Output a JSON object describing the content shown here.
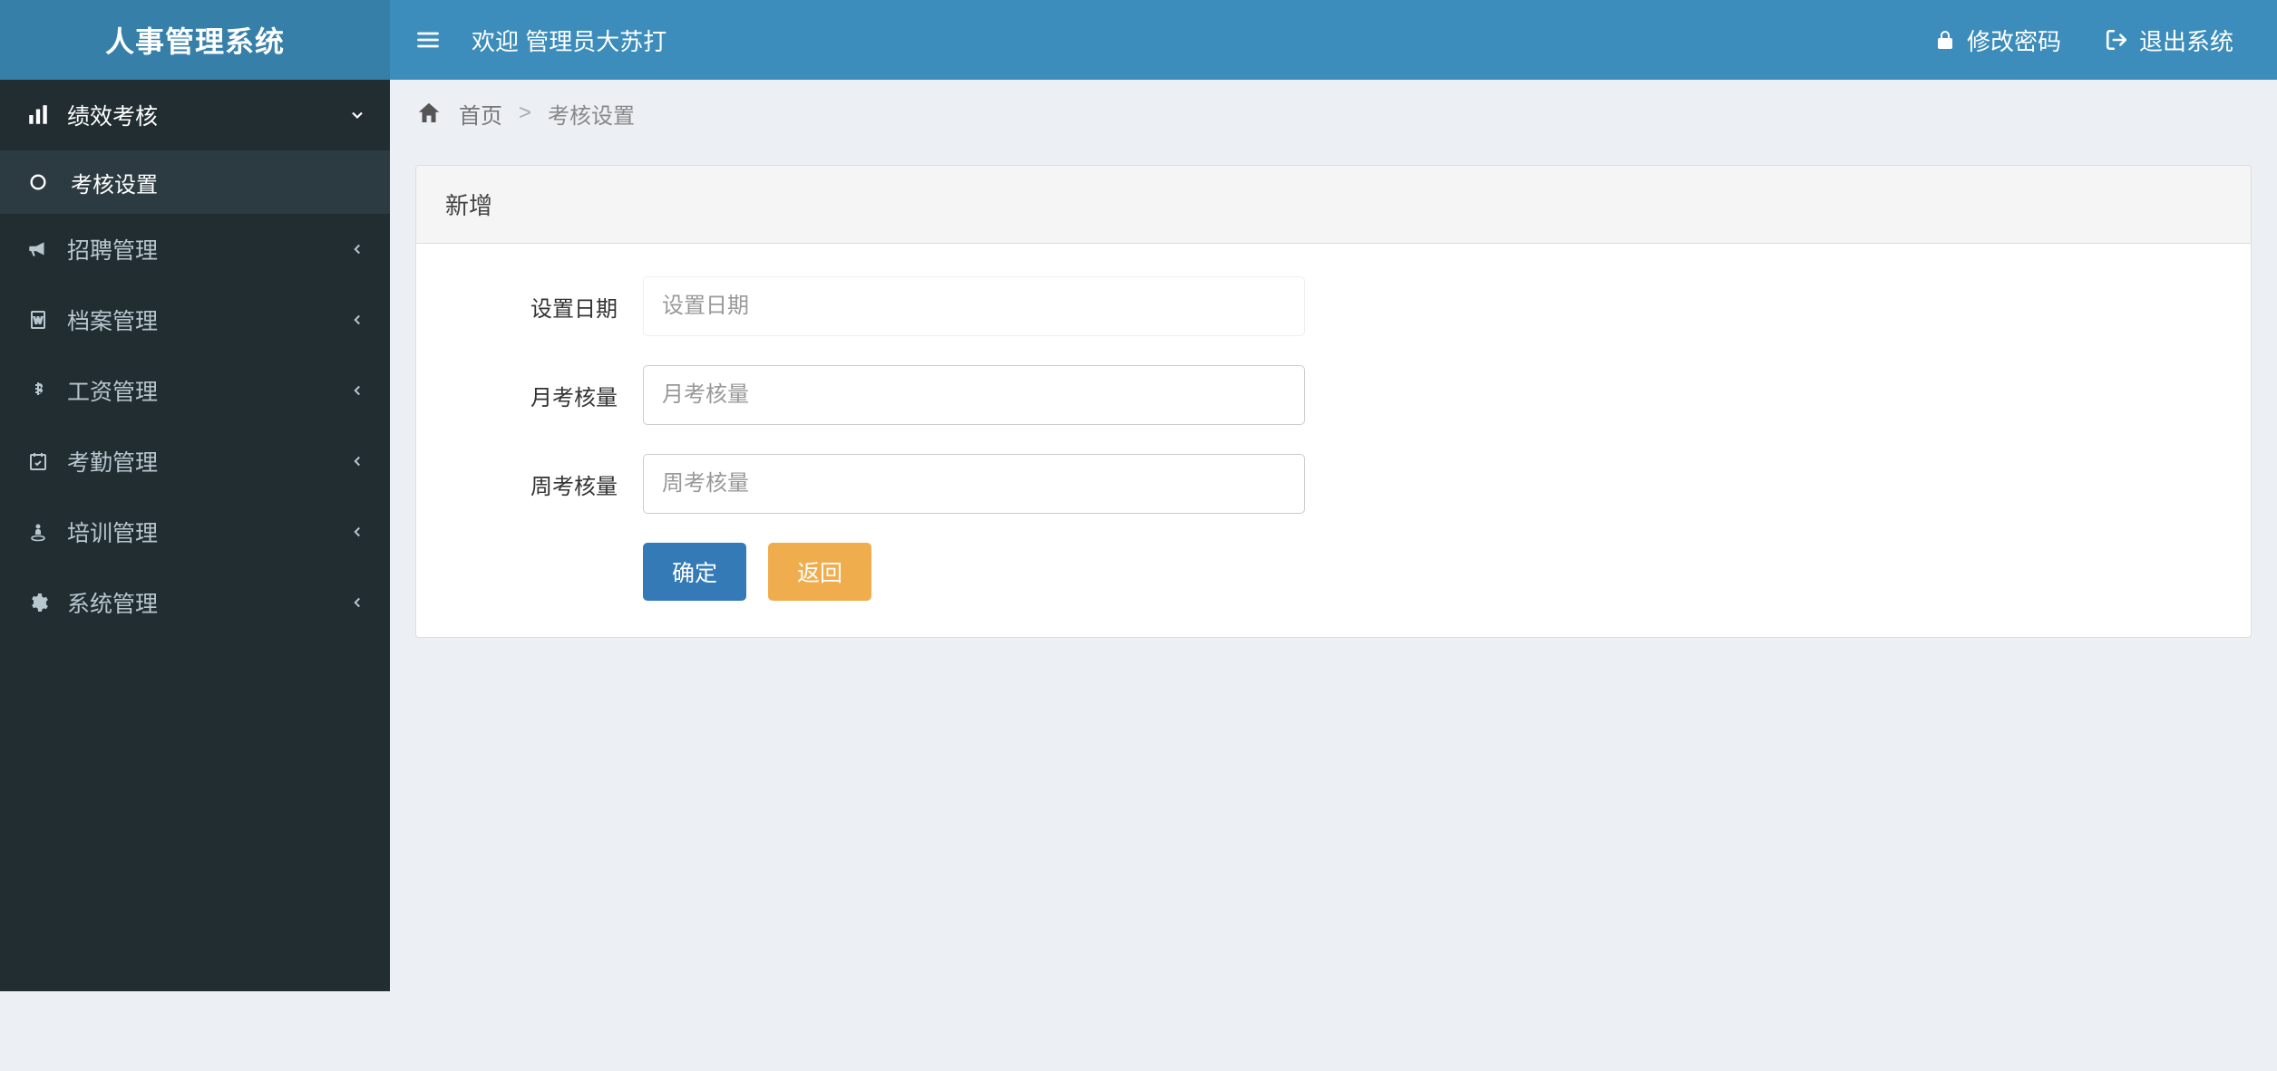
{
  "app": {
    "title": "人事管理系统"
  },
  "header": {
    "welcome": "欢迎 管理员大苏打",
    "change_password": "修改密码",
    "logout": "退出系统"
  },
  "sidebar": {
    "items": [
      {
        "label": "绩效考核",
        "expanded": true,
        "children": [
          {
            "label": "考核设置"
          }
        ]
      },
      {
        "label": "招聘管理"
      },
      {
        "label": "档案管理"
      },
      {
        "label": "工资管理"
      },
      {
        "label": "考勤管理"
      },
      {
        "label": "培训管理"
      },
      {
        "label": "系统管理"
      }
    ]
  },
  "breadcrumb": {
    "home": "首页",
    "current": "考核设置"
  },
  "panel": {
    "title": "新增"
  },
  "form": {
    "date_label": "设置日期",
    "date_placeholder": "设置日期",
    "month_label": "月考核量",
    "month_placeholder": "月考核量",
    "week_label": "周考核量",
    "week_placeholder": "周考核量",
    "submit": "确定",
    "back": "返回"
  }
}
